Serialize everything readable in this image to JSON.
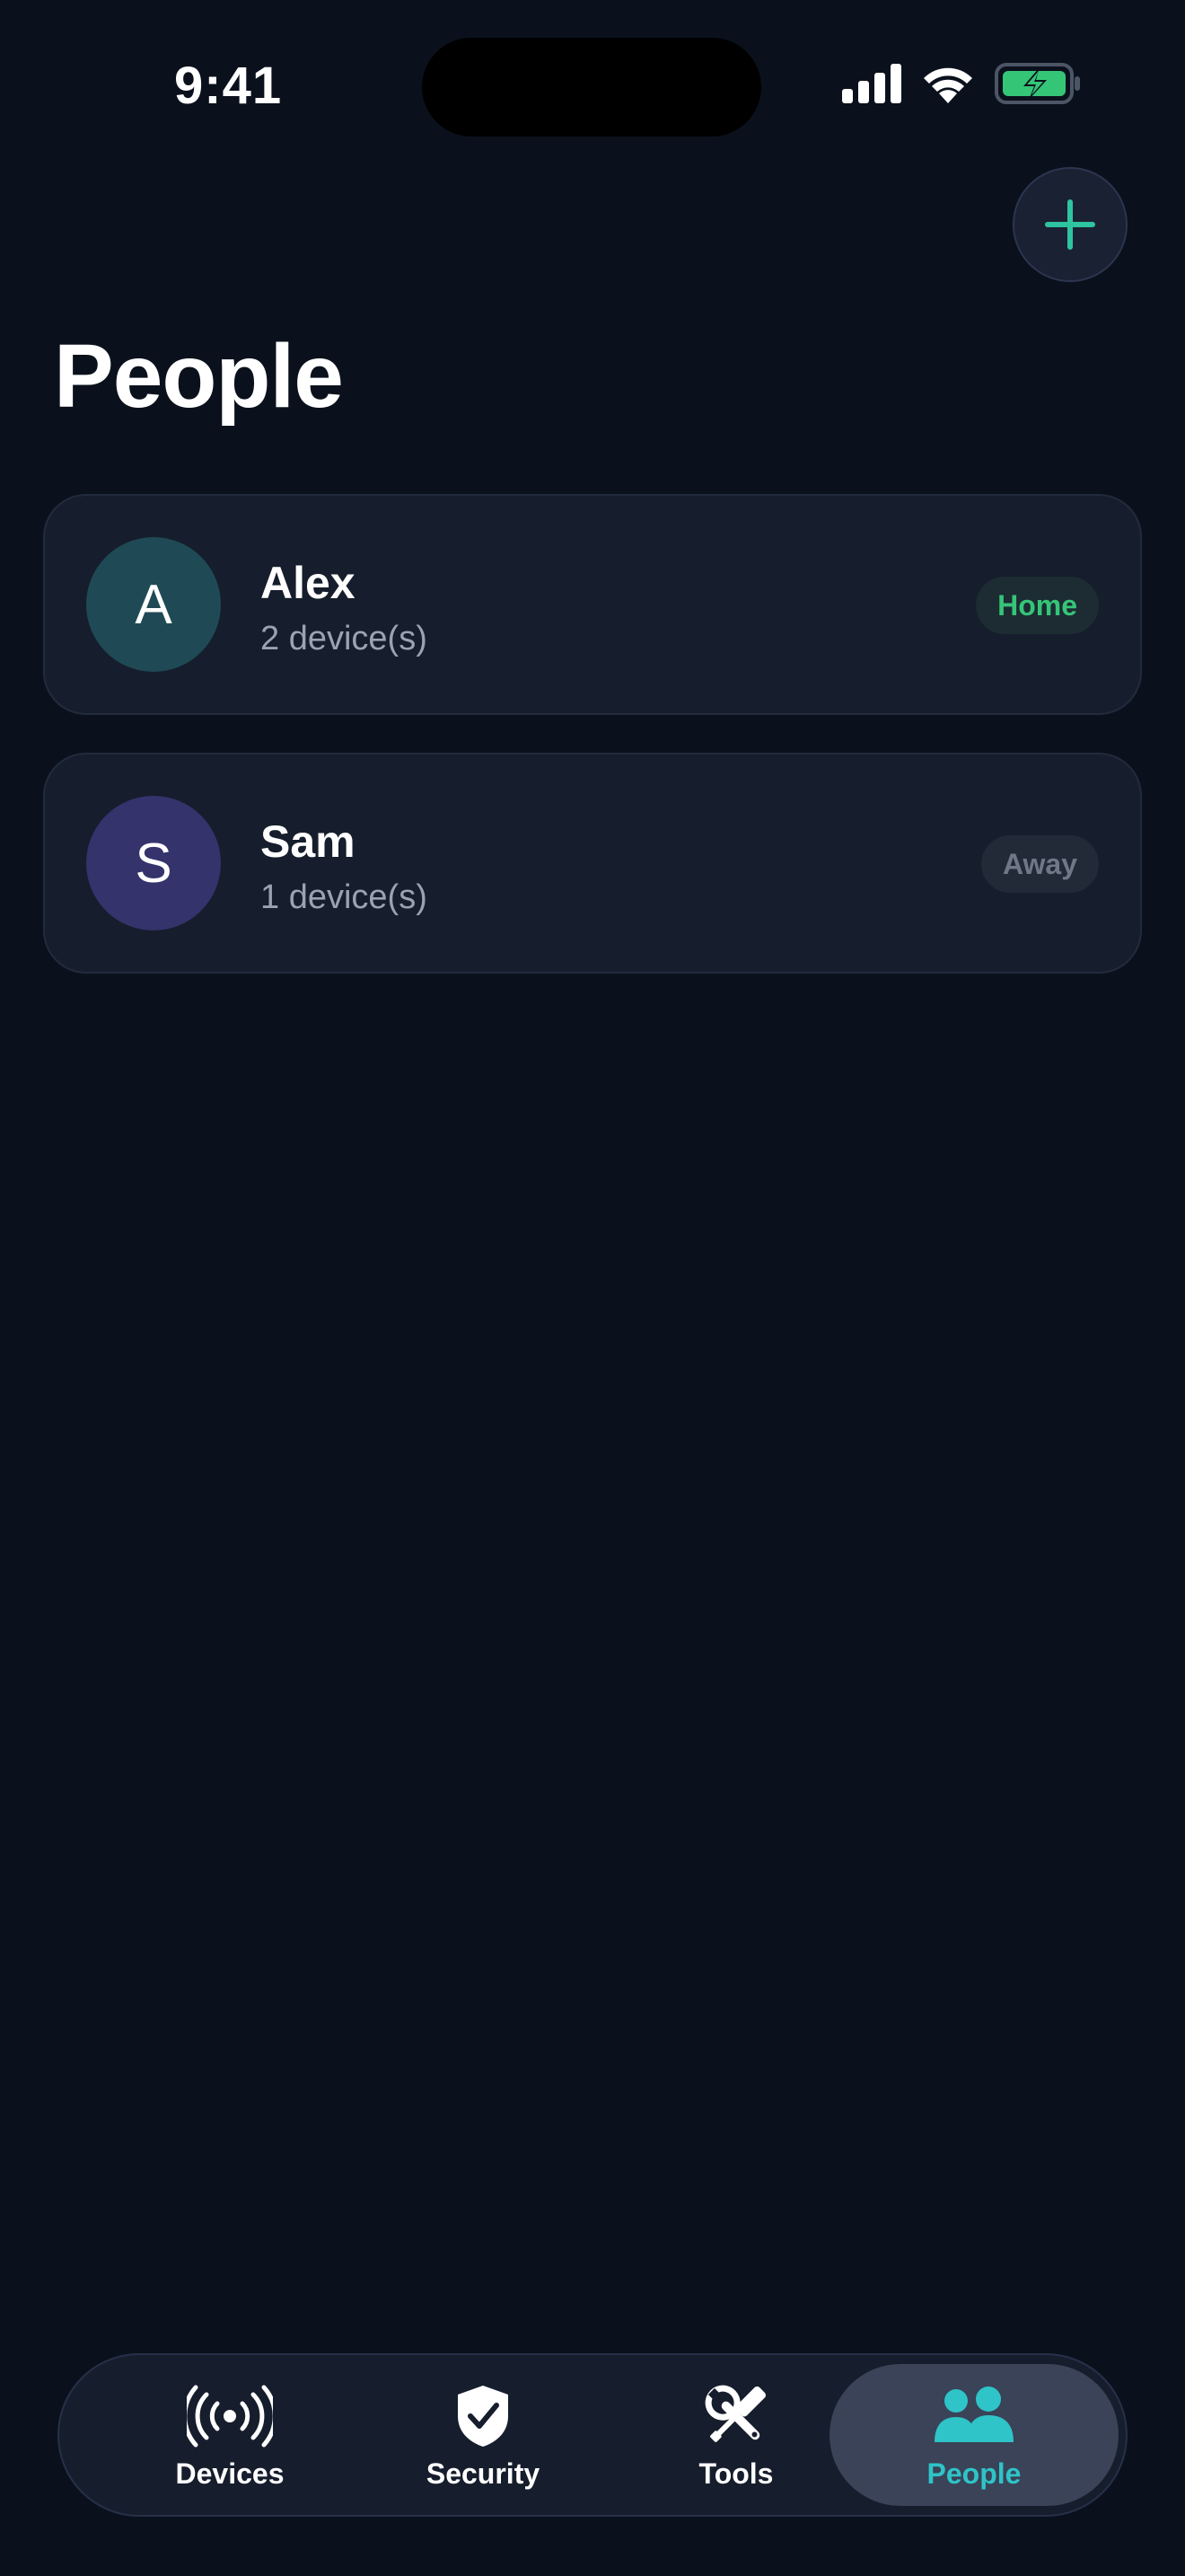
{
  "status_bar": {
    "time": "9:41"
  },
  "header": {
    "title": "People",
    "add_icon": "plus-icon"
  },
  "people": [
    {
      "initial": "A",
      "name": "Alex",
      "devices": "2 device(s)",
      "status": "Home",
      "avatar_color": "#1f4a55"
    },
    {
      "initial": "S",
      "name": "Sam",
      "devices": "1 device(s)",
      "status": "Away",
      "avatar_color": "#34336b"
    }
  ],
  "tab_bar": {
    "tabs": [
      {
        "label": "Devices",
        "icon": "broadcast-icon"
      },
      {
        "label": "Security",
        "icon": "shield-check-icon"
      },
      {
        "label": "Tools",
        "icon": "tools-icon"
      },
      {
        "label": "People",
        "icon": "people-icon",
        "selected": true
      }
    ]
  },
  "colors": {
    "accent": "#2ec4c8",
    "home_status": "#35c577",
    "away_status": "#6f7888",
    "background": "#0b111c",
    "card": "#161d2c"
  }
}
